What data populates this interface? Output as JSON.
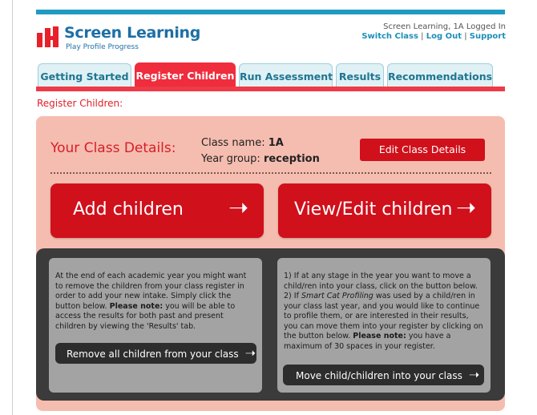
{
  "brand": {
    "title": "Screen Learning",
    "subtitle": "Play Profile Progress",
    "colors": {
      "blue": "#1d6fa5",
      "red": "#d0101b",
      "topbar": "#1f9bc1"
    }
  },
  "user": {
    "status": "Screen Learning, 1A Logged In",
    "switch_class": "Switch Class",
    "log_out": "Log Out",
    "support": "Support",
    "separator": "|"
  },
  "tabs": [
    {
      "label": "Getting Started",
      "active": false
    },
    {
      "label": "Register Children",
      "active": true
    },
    {
      "label": "Run Assessment",
      "active": false
    },
    {
      "label": "Results",
      "active": false
    },
    {
      "label": "Recommendations",
      "active": false
    }
  ],
  "breadcrumb": "Register Children:",
  "class_details": {
    "title": "Your Class Details:",
    "class_name_label": "Class name:",
    "class_name_value": "1A",
    "year_group_label": "Year group:",
    "year_group_value": "reception",
    "edit_button": "Edit Class Details"
  },
  "actions": {
    "add_children": "Add children",
    "view_edit_children": "View/Edit children",
    "arrow_icon": "right-arrow-icon"
  },
  "left_info": {
    "text_1": "At the end of each academic year you might want to remove the children from your class register in order to add your new intake. Simply click the button below.",
    "note_label": "Please note:",
    "text_2": " you will be able to access the results for both past and present children by viewing the 'Results' tab.",
    "button": "Remove all children from your class"
  },
  "right_info": {
    "text_1": "1) If at any stage in the year you want to move a child/ren into your class, click on the button below.",
    "text_2a": "2) If ",
    "product": "Smart Cat Profiling",
    "text_2b": " was used by a child/ren in your class last year, and you would like to continue to profile them, or are interested in their results, you can move them into your register by clicking on the button below. ",
    "note_label": "Please note:",
    "text_3": " you have a maximum of 30 spaces in your register.",
    "button": "Move child/children into your class"
  }
}
